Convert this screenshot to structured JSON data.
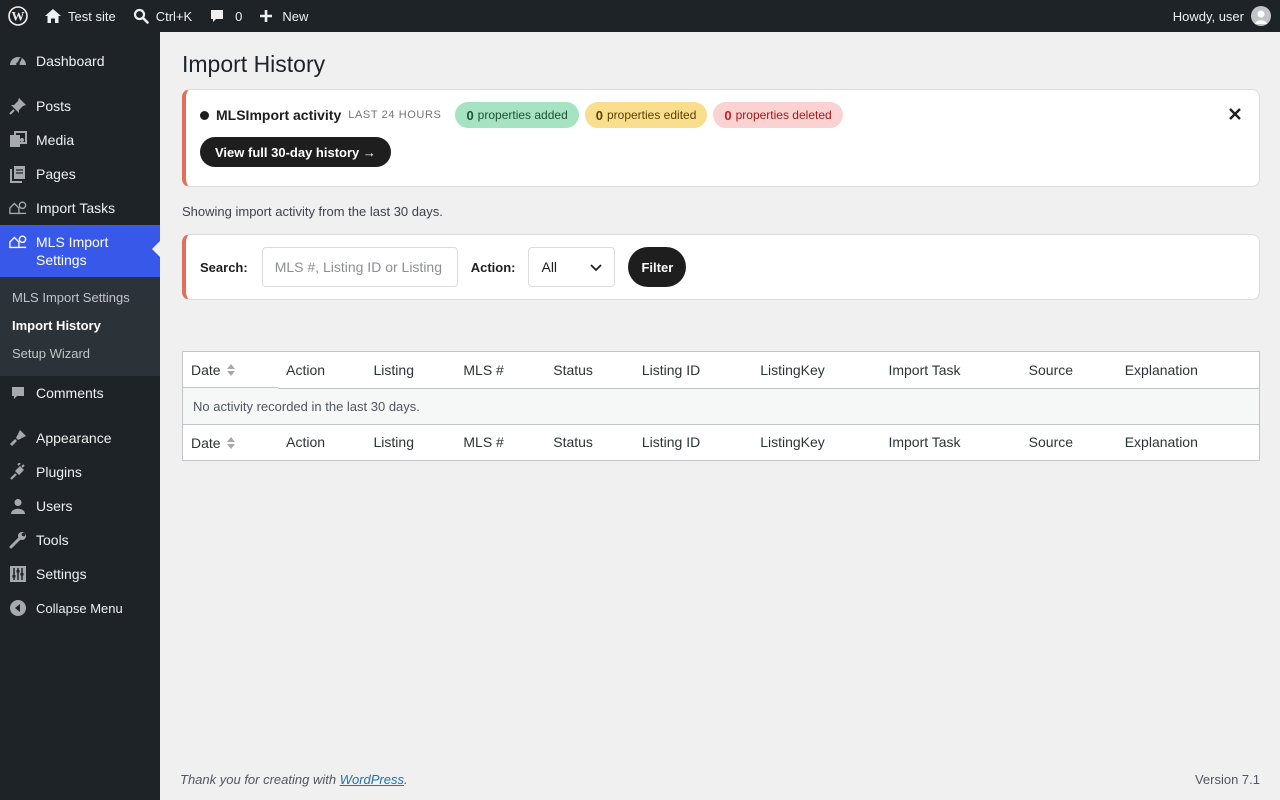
{
  "adminbar": {
    "site_name": "Test site",
    "search_shortcut": "Ctrl+K",
    "comments_count": "0",
    "new_label": "New",
    "howdy": "Howdy, user"
  },
  "sidebar": {
    "items": [
      {
        "label": "Dashboard",
        "icon": "dashboard-icon"
      },
      {
        "label": "Posts",
        "icon": "pin-icon"
      },
      {
        "label": "Media",
        "icon": "media-icon"
      },
      {
        "label": "Pages",
        "icon": "pages-icon"
      },
      {
        "label": "Import Tasks",
        "icon": "import-tasks-icon"
      },
      {
        "label": "MLS Import Settings",
        "icon": "mls-import-icon"
      },
      {
        "label": "Comments",
        "icon": "comment-icon"
      },
      {
        "label": "Appearance",
        "icon": "appearance-icon"
      },
      {
        "label": "Plugins",
        "icon": "plugins-icon"
      },
      {
        "label": "Users",
        "icon": "users-icon"
      },
      {
        "label": "Tools",
        "icon": "tools-icon"
      },
      {
        "label": "Settings",
        "icon": "settings-icon"
      },
      {
        "label": "Collapse Menu",
        "icon": "collapse-icon"
      }
    ],
    "submenu": [
      "MLS Import Settings",
      "Import History",
      "Setup Wizard"
    ]
  },
  "page": {
    "title": "Import History",
    "showing_text": "Showing import activity from the last 30 days."
  },
  "notice": {
    "brand": "MLSImport activity",
    "period": "LAST 24 HOURS",
    "added_count": "0",
    "added_label": "properties added",
    "edited_count": "0",
    "edited_label": "properties edited",
    "deleted_count": "0",
    "deleted_label": "properties deleted",
    "history_button": "View full 30-day history →"
  },
  "filter": {
    "search_label": "Search:",
    "search_placeholder": "MLS #, Listing ID or Listing",
    "action_label": "Action:",
    "action_value": "All",
    "filter_button": "Filter"
  },
  "table": {
    "columns": [
      "Date",
      "Action",
      "Listing",
      "MLS #",
      "Status",
      "Listing ID",
      "ListingKey",
      "Import Task",
      "Source",
      "Explanation"
    ],
    "empty_message": "No activity recorded in the last 30 days."
  },
  "footer": {
    "thanks_prefix": "Thank you for creating with ",
    "wordpress_link": "WordPress",
    "thanks_suffix": ".",
    "version": "Version 7.1"
  },
  "colors": {
    "accent": "#3858e9",
    "notice_border": "#e26f56",
    "added_bg": "#a6e3c2",
    "edited_bg": "#f8de8d",
    "deleted_bg": "#fbd2d2"
  }
}
